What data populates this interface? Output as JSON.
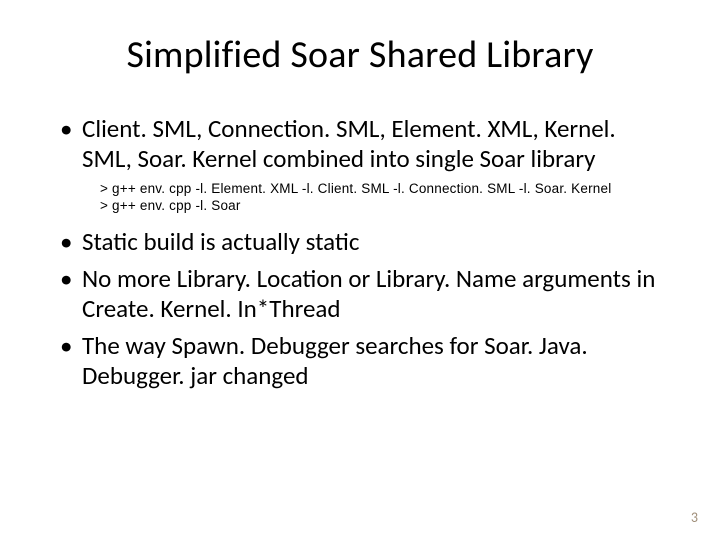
{
  "title": "Simplified Soar Shared Library",
  "bullets": {
    "b1": "Client. SML, Connection. SML, Element. XML, Kernel. SML, Soar. Kernel combined into single Soar library",
    "code1": "> g++ env. cpp -l. Element. XML -l. Client. SML -l. Connection. SML -l. Soar. Kernel",
    "code2": "> g++ env. cpp -l. Soar",
    "b2": "Static build is actually static",
    "b3": "No more Library. Location or Library. Name arguments in Create. Kernel. In*Thread",
    "b4": "The way Spawn. Debugger searches for Soar. Java. Debugger. jar changed"
  },
  "page_number": "3"
}
